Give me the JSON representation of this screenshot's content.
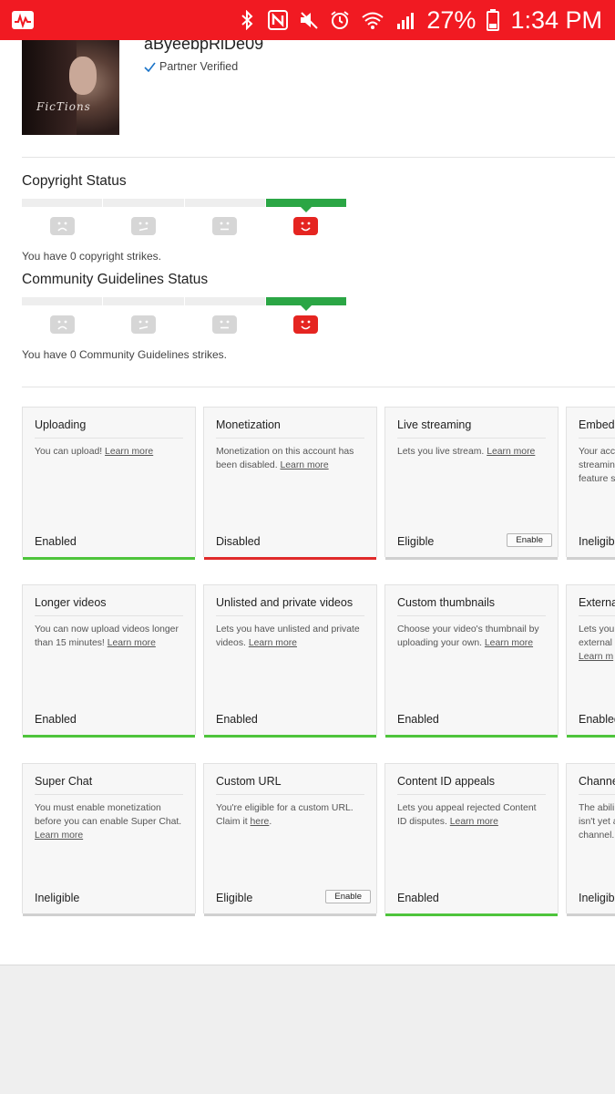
{
  "status_bar": {
    "battery_percent": "27%",
    "time": "1:34 PM",
    "icons": [
      "activity-app-icon",
      "bluetooth-icon",
      "nfc-icon",
      "mute-icon",
      "alarm-icon",
      "wifi-icon",
      "signal-icon",
      "battery-icon"
    ]
  },
  "profile": {
    "username": "aByeebpRiDe09",
    "verified_label": "Partner Verified",
    "avatar_signature": "FicTions"
  },
  "copyright": {
    "title": "Copyright Status",
    "strikes_text": "You have 0 copyright strikes."
  },
  "community": {
    "title": "Community Guidelines Status",
    "strikes_text": "You have 0 Community Guidelines strikes."
  },
  "features": {
    "row1": [
      {
        "title": "Uploading",
        "desc": "You can upload!",
        "link": "Learn more",
        "state": "Enabled"
      },
      {
        "title": "Monetization",
        "desc": "Monetization on this account has been disabled.",
        "link": "Learn more",
        "state": "Disabled"
      },
      {
        "title": "Live streaming",
        "desc": "Lets you live stream.",
        "link": "Learn more",
        "state": "Eligible",
        "button": "Enable"
      },
      {
        "title": "Embed",
        "desc": "Your acc streamin feature s",
        "link": "",
        "state": "Ineligib"
      }
    ],
    "row2": [
      {
        "title": "Longer videos",
        "desc": "You can now upload videos longer than 15 minutes!",
        "link": "Learn more",
        "state": "Enabled"
      },
      {
        "title": "Unlisted and private videos",
        "desc": "Lets you have unlisted and private videos.",
        "link": "Learn more",
        "state": "Enabled"
      },
      {
        "title": "Custom thumbnails",
        "desc": "Choose your video's thumbnail by uploading your own.",
        "link": "Learn more",
        "state": "Enabled"
      },
      {
        "title": "Externa",
        "desc": "Lets you external",
        "link": "Learn m",
        "state": "Enabled"
      }
    ],
    "row3": [
      {
        "title": "Super Chat",
        "desc": "You must enable monetization before you can enable Super Chat.",
        "link": "Learn more",
        "state": "Ineligible"
      },
      {
        "title": "Custom URL",
        "desc": "You're eligible for a custom URL. Claim it",
        "link": "here",
        "state": "Eligible",
        "button": "Enable"
      },
      {
        "title": "Content ID appeals",
        "desc": "Lets you appeal rejected Content ID disputes.",
        "link": "Learn more",
        "state": "Enabled"
      },
      {
        "title": "Channe",
        "desc": "The abili isn't yet a channel.",
        "link": "",
        "state": "Ineligib"
      }
    ]
  },
  "colors": {
    "status_bar": "#f11a22",
    "meter_active": "#2ba645",
    "enabled_bar": "#4ec43b",
    "disabled_bar": "#e02a2a",
    "neutral_bar": "#d0d0d0"
  }
}
